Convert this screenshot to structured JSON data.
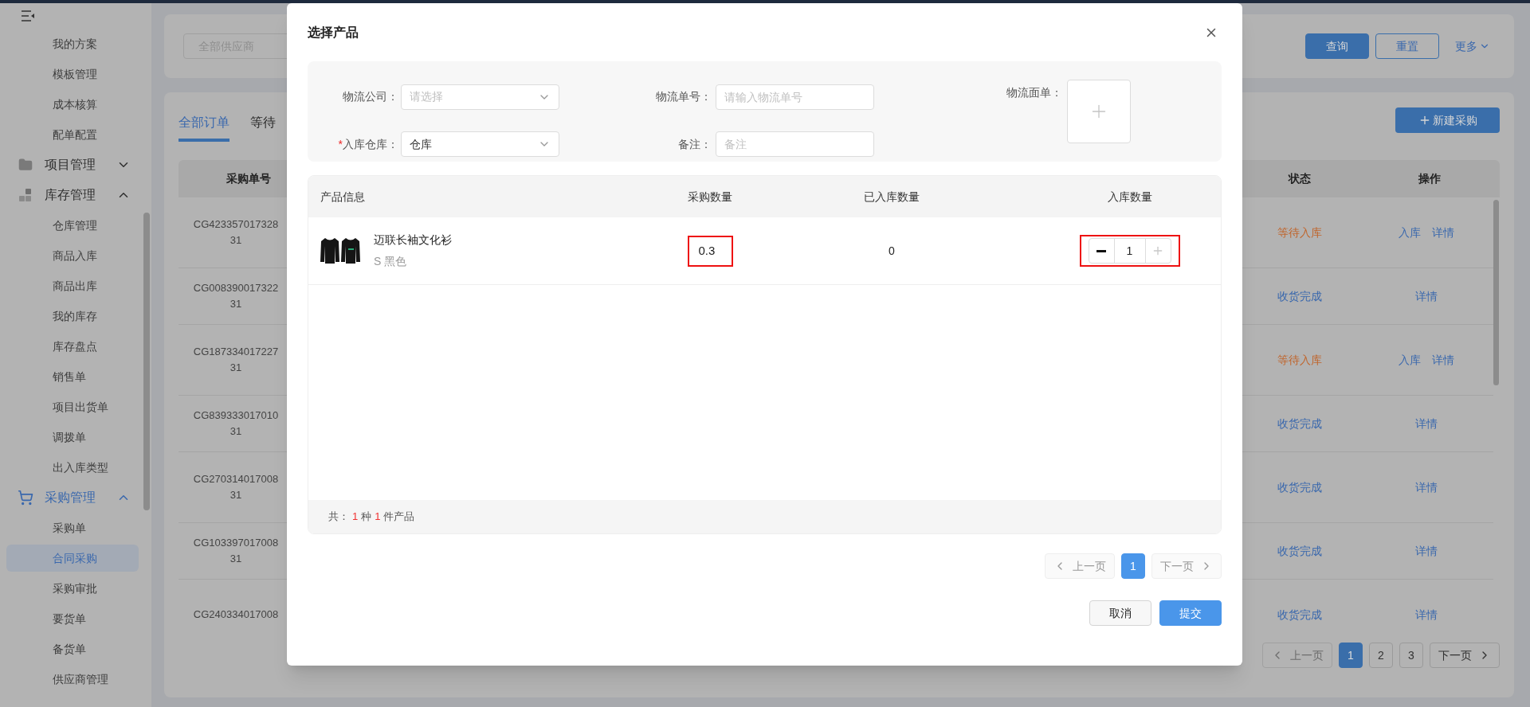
{
  "sidebar": {
    "items": [
      {
        "kind": "link",
        "label": "我的方案",
        "selected": false
      },
      {
        "kind": "link",
        "label": "模板管理",
        "selected": false
      },
      {
        "kind": "link",
        "label": "成本核算",
        "selected": false
      },
      {
        "kind": "link",
        "label": "配单配置",
        "selected": false
      },
      {
        "kind": "group",
        "label": "项目管理",
        "expanded": false,
        "selected": false
      },
      {
        "kind": "group",
        "label": "库存管理",
        "expanded": true,
        "selected": false,
        "children": [
          {
            "label": "仓库管理",
            "selected": false
          },
          {
            "label": "商品入库",
            "selected": false
          },
          {
            "label": "商品出库",
            "selected": false
          },
          {
            "label": "我的库存",
            "selected": false
          },
          {
            "label": "库存盘点",
            "selected": false
          },
          {
            "label": "销售单",
            "selected": false
          },
          {
            "label": "项目出货单",
            "selected": false
          },
          {
            "label": "调拨单",
            "selected": false
          },
          {
            "label": "出入库类型",
            "selected": false
          }
        ]
      },
      {
        "kind": "group",
        "label": "采购管理",
        "expanded": true,
        "selected": true,
        "children": [
          {
            "label": "采购单",
            "selected": false
          },
          {
            "label": "合同采购",
            "selected": true
          },
          {
            "label": "采购审批",
            "selected": false
          },
          {
            "label": "要货单",
            "selected": false
          },
          {
            "label": "备货单",
            "selected": false
          },
          {
            "label": "供应商管理",
            "selected": false
          }
        ]
      }
    ]
  },
  "filter": {
    "supplier_placeholder": "全部供应商",
    "buttons": [
      {
        "label": "查询",
        "kind": "primary"
      },
      {
        "label": "重置",
        "kind": "outline"
      }
    ],
    "more": "更多"
  },
  "orders": {
    "tabs": [
      {
        "label": "全部订单",
        "selected": true
      },
      {
        "label": "等待",
        "selected": false
      }
    ],
    "new_button": "新建采购",
    "columns": [
      "采购单号",
      "状态",
      "操作"
    ],
    "rows": [
      {
        "order_no": "CG423357017328\n31",
        "status": "等待入库",
        "color": "#c0642a",
        "actions": [
          "入库",
          "详情"
        ]
      },
      {
        "order_no": "CG008390017322\n31",
        "status": "收货完成",
        "color": "#3a68ad",
        "actions": [
          "详情"
        ]
      },
      {
        "order_no": "CG187334017227\n31",
        "status": "等待入库",
        "color": "#c0642a",
        "actions": [
          "入库",
          "详情"
        ]
      },
      {
        "order_no": "CG839333017010\n31",
        "status": "收货完成",
        "color": "#3a68ad",
        "actions": [
          "详情"
        ]
      },
      {
        "order_no": "CG270314017008\n31",
        "status": "收货完成",
        "color": "#3a68ad",
        "actions": [
          "详情"
        ]
      },
      {
        "order_no": "CG103397017008\n31",
        "status": "收货完成",
        "color": "#3a68ad",
        "actions": [
          "详情"
        ]
      },
      {
        "order_no": "CG240334017008",
        "status": "收货完成",
        "color": "#3a68ad",
        "actions": [
          "详情"
        ]
      }
    ],
    "pagination": {
      "prev": "上一页",
      "prev_disabled": true,
      "pages": [
        {
          "label": "1",
          "selected": true
        },
        {
          "label": "2",
          "selected": false
        },
        {
          "label": "3",
          "selected": false
        }
      ],
      "next": "下一页",
      "next_disabled": false
    }
  },
  "modal": {
    "title": "选择产品",
    "fields": [
      {
        "kind": "select",
        "label": "物流公司：",
        "placeholder": "请选择"
      },
      {
        "kind": "input",
        "label": "物流单号：",
        "placeholder": "请输入物流单号"
      },
      {
        "kind": "select",
        "label": "入库仓库：",
        "required_mark": "*",
        "value": "仓库"
      },
      {
        "kind": "input",
        "label": "备注：",
        "placeholder": "备注"
      }
    ],
    "upload": {
      "label": "物流面单："
    },
    "products": {
      "columns": [
        "产品信息",
        "采购数量",
        "已入库数量",
        "入库数量"
      ],
      "rows": [
        {
          "name": "迈联长袖文化衫",
          "spec": "S 黑色",
          "ordered": "0.3",
          "ordered_highlighted": true,
          "received": "0",
          "quantity": "1",
          "quantity_highlighted": true,
          "minus_disabled": false,
          "plus_disabled": true
        }
      ],
      "summary": [
        {
          "text": "共：",
          "highlight": false
        },
        {
          "text": "1",
          "highlight": true
        },
        {
          "text": "种",
          "highlight": false
        },
        {
          "text": "1",
          "highlight": true
        },
        {
          "text": "件产品",
          "highlight": false
        }
      ]
    },
    "pagination": {
      "prev": "上一页",
      "prev_disabled": true,
      "pages": [
        {
          "label": "1",
          "selected": true
        }
      ],
      "next": "下一页",
      "next_disabled": true
    },
    "buttons": [
      {
        "label": "取消",
        "kind": "default"
      },
      {
        "label": "提交",
        "kind": "primary"
      }
    ]
  }
}
